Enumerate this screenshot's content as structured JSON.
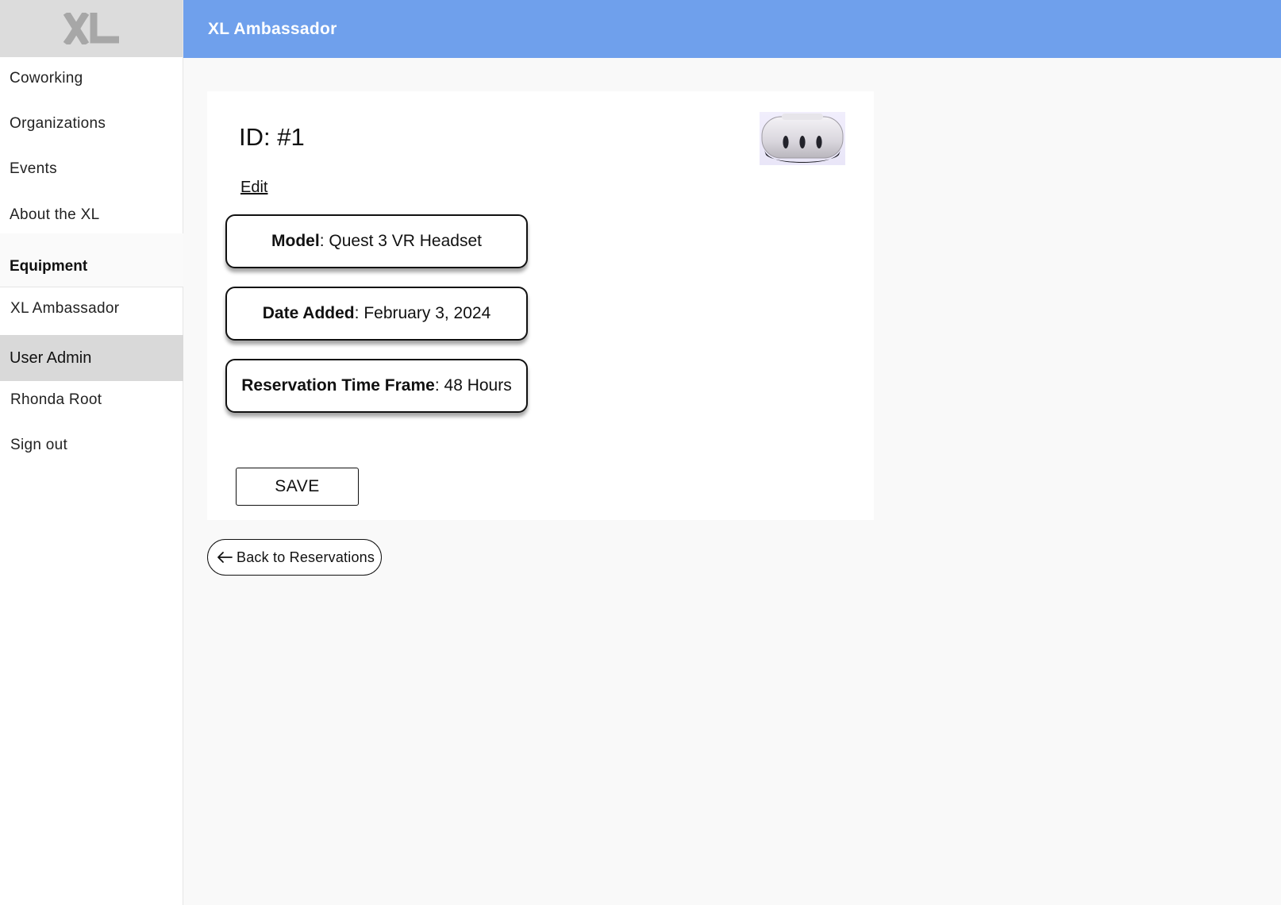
{
  "app": {
    "logo_text": "XL"
  },
  "sidebar": {
    "items": [
      {
        "label": "Coworking"
      },
      {
        "label": "Organizations"
      },
      {
        "label": "Events"
      },
      {
        "label": "About the XL"
      }
    ],
    "equipment_section": {
      "label": "Equipment",
      "items": [
        {
          "label": "XL Ambassador"
        }
      ]
    },
    "user_admin_section": {
      "label": "User Admin",
      "items": [
        {
          "label": "Rhonda Root"
        },
        {
          "label": "Sign out"
        }
      ]
    }
  },
  "header": {
    "title": "XL Ambassador",
    "color": "#6fa0ec"
  },
  "detail": {
    "id_label": "ID: #1",
    "edit_label": "Edit",
    "image_icon": "vr-headset-image",
    "fields": [
      {
        "label": "Model",
        "value": "Quest 3 VR Headset"
      },
      {
        "label": "Date Added",
        "value": "February 3, 2024"
      },
      {
        "label": "Reservation Time Frame",
        "value": "48 Hours"
      }
    ],
    "separator": ":",
    "save_label": "SAVE"
  },
  "back": {
    "label": "Back to Reservations",
    "icon": "arrow-left-icon"
  }
}
